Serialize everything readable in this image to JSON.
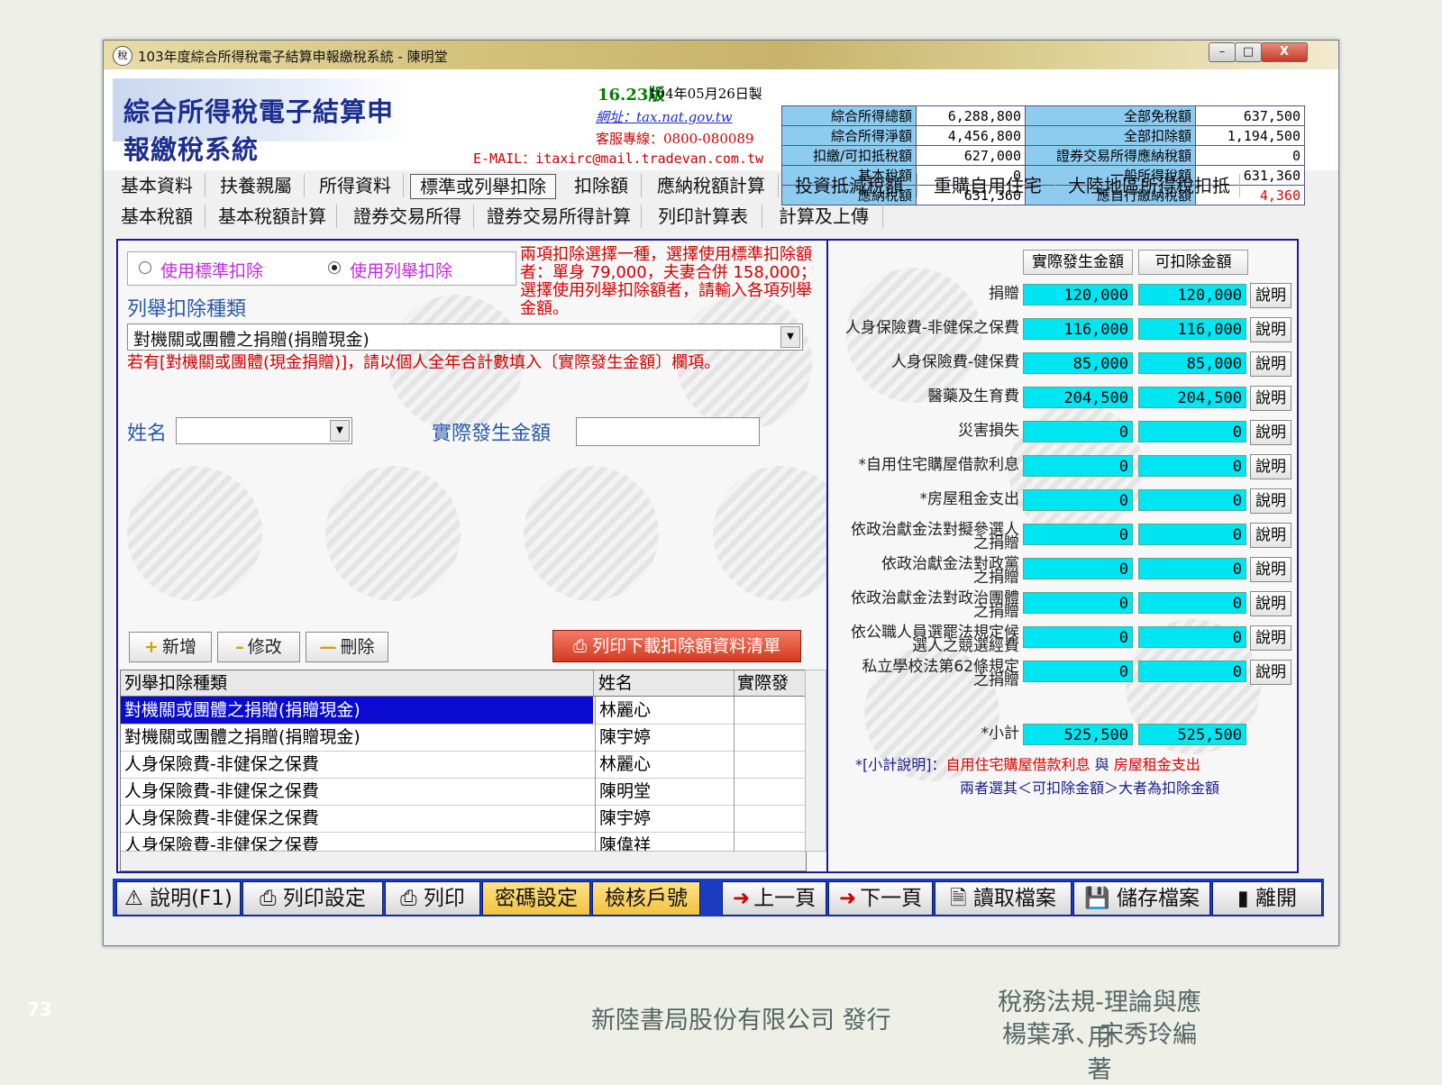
{
  "window": {
    "title": "103年度綜合所得稅電子結算申報繳稅系統 - 陳明堂",
    "minimize": "–",
    "maximize": "□",
    "close": "X"
  },
  "header": {
    "logo_text": "綜合所得稅電子結算申報繳稅系統",
    "version": "16.23版",
    "version_date": "104年05月26日製",
    "website": "網址：tax.nat.gov.tw",
    "hotline": "客服專線：0800-080089",
    "email": "E-MAIL：itaxirc@mail.tradevan.com.tw"
  },
  "summary": [
    {
      "label1": "綜合所得總額",
      "value1": "6,288,800",
      "label2": "全部免稅額",
      "value2": "637,500"
    },
    {
      "label1": "綜合所得淨額",
      "value1": "4,456,800",
      "label2": "全部扣除額",
      "value2": "1,194,500"
    },
    {
      "label1": "扣繳/可扣抵稅額",
      "value1": "627,000",
      "label2": "證券交易所得應納稅額",
      "value2": "0"
    },
    {
      "label1": "基本稅額",
      "value1": "0",
      "label2": "一般所得稅額",
      "value2": "631,360"
    },
    {
      "label1": "應納稅額",
      "value1": "631,360",
      "label2": "應自行繳納稅額",
      "value2": "4,360"
    }
  ],
  "menu_row1": [
    "基本資料",
    "扶養親屬",
    "所得資料",
    "標準或列舉扣除",
    "扣除額",
    "應納稅額計算",
    "投資抵減稅額",
    "重購自用住宅",
    "大陸地區所得稅扣抵"
  ],
  "menu_row2": [
    "基本稅額",
    "基本稅額計算",
    "證券交易所得",
    "證券交易所得計算",
    "列印計算表",
    "計算及上傳"
  ],
  "left": {
    "radio_standard": "使用標準扣除",
    "radio_itemized": "使用列舉扣除",
    "notice": "兩項扣除選擇一種，選擇使用標準扣除額者：單身 79,000，夫妻合併 158,000；選擇使用列舉扣除額者，請輸入各項列舉金額。",
    "category_label": "列舉扣除種類",
    "category_value": "對機關或團體之捐贈(捐贈現金)",
    "category_note": "若有[對機關或團體(現金捐贈)]，請以個人全年合計數填入〔實際發生金額〕欄項。",
    "name_label": "姓名",
    "amount_label": "實際發生金額",
    "btn_add": "新增",
    "btn_edit": "修改",
    "btn_delete": "刪除",
    "btn_print_list": "列印下載扣除額資料清單",
    "grid_headers": [
      "列舉扣除種類",
      "姓名",
      "實際發"
    ],
    "grid_rows": [
      {
        "type": "對機關或團體之捐贈(捐贈現金)",
        "name": "林麗心"
      },
      {
        "type": "對機關或團體之捐贈(捐贈現金)",
        "name": "陳宇婷"
      },
      {
        "type": "人身保險費-非健保之保費",
        "name": "林麗心"
      },
      {
        "type": "人身保險費-非健保之保費",
        "name": "陳明堂"
      },
      {
        "type": "人身保險費-非健保之保費",
        "name": "陳宇婷"
      },
      {
        "type": "人身保險費-非健保之保費",
        "name": "陳偉祥"
      }
    ]
  },
  "right": {
    "col_actual": "實際發生金額",
    "col_deductible": "可扣除金額",
    "explain": "說明",
    "rows": [
      {
        "label": "捐贈",
        "actual": "120,000",
        "deductible": "120,000"
      },
      {
        "label": "人身保險費-非健保之保費",
        "actual": "116,000",
        "deductible": "116,000"
      },
      {
        "label": "人身保險費-健保費",
        "actual": "85,000",
        "deductible": "85,000"
      },
      {
        "label": "醫藥及生育費",
        "actual": "204,500",
        "deductible": "204,500"
      },
      {
        "label": "災害損失",
        "actual": "0",
        "deductible": "0"
      },
      {
        "label": "*自用住宅購屋借款利息",
        "actual": "0",
        "deductible": "0"
      },
      {
        "label": "*房屋租金支出",
        "actual": "0",
        "deductible": "0"
      },
      {
        "label": "依政治獻金法對擬參選人",
        "label2": "之捐贈",
        "actual": "0",
        "deductible": "0"
      },
      {
        "label": "依政治獻金法對政黨",
        "label2": "之捐贈",
        "actual": "0",
        "deductible": "0"
      },
      {
        "label": "依政治獻金法對政治團體",
        "label2": "之捐贈",
        "actual": "0",
        "deductible": "0"
      },
      {
        "label": "依公職人員選罷法規定候",
        "label2": "選人之競選經費",
        "actual": "0",
        "deductible": "0"
      },
      {
        "label": "私立學校法第62條規定",
        "label2": "之捐贈",
        "actual": "0",
        "deductible": "0"
      }
    ],
    "subtotal_label": "*小計",
    "subtotal_actual": "525,500",
    "subtotal_deductible": "525,500",
    "note_prefix": "*[小計說明]：",
    "note_item1": "自用住宅購屋借款利息",
    "note_and": " 與 ",
    "note_item2": "房屋租金支出",
    "note_line2": "兩者選其＜可扣除金額＞大者為扣除金額"
  },
  "bottom_bar": [
    "說明(F1)",
    "列印設定",
    "列印",
    "密碼設定",
    "檢核戶號",
    "上一頁",
    "下一頁",
    "讀取檔案",
    "儲存檔案",
    "離開"
  ],
  "footer": {
    "page_number": "73",
    "publisher": "新陸書局股份有限公司 發行",
    "book_title": "稅務法規-理論與應用",
    "book_authors": "楊葉承、宋秀玲編著"
  },
  "colors": {
    "accent_blue": "#1b3cc0",
    "cyan_field": "#00e5f2",
    "summary_label": "#8ecbf0",
    "alert_red": "#e00000"
  }
}
